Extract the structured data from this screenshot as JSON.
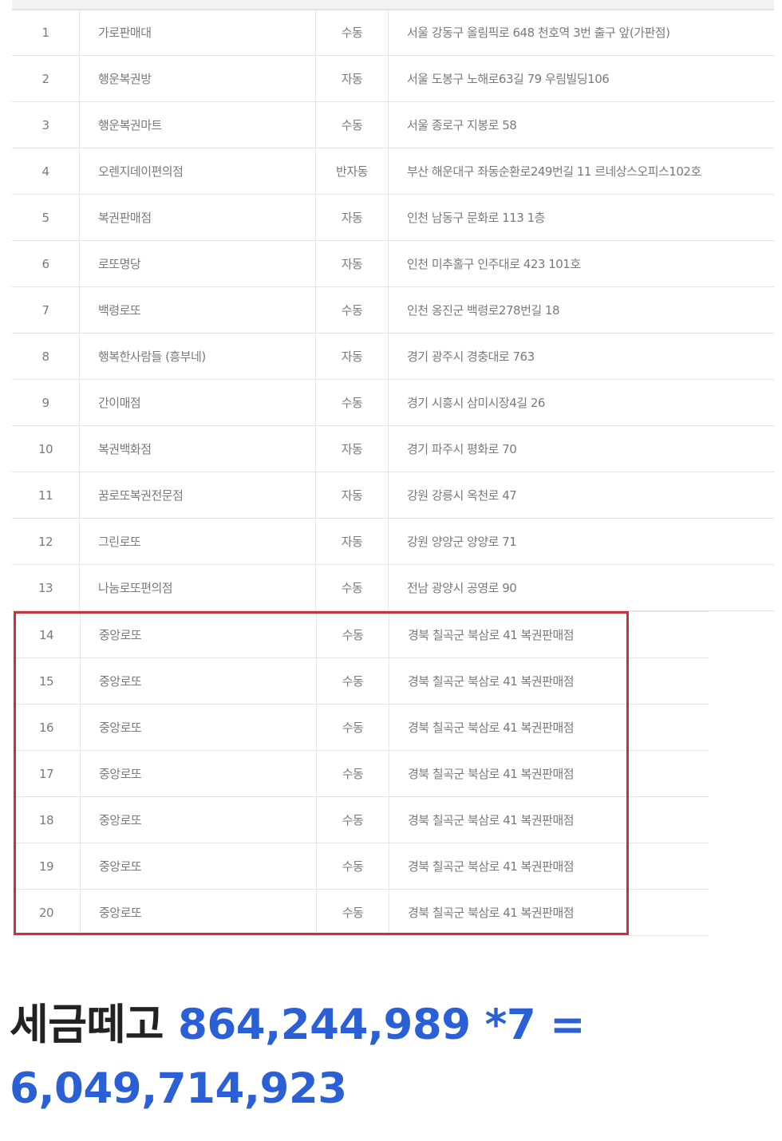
{
  "table": {
    "rows": [
      {
        "no": "1",
        "name": "가로판매대",
        "type": "수동",
        "address": "서울 강동구 올림픽로 648 천호역 3번 출구 앞(가판점)"
      },
      {
        "no": "2",
        "name": "행운복권방",
        "type": "자동",
        "address": "서울 도봉구 노해로63길 79 우림빌딩106"
      },
      {
        "no": "3",
        "name": "행운복권마트",
        "type": "수동",
        "address": "서울 종로구 지봉로 58"
      },
      {
        "no": "4",
        "name": "오렌지데이편의점",
        "type": "반자동",
        "address": "부산 해운대구 좌동순환로249번길 11 르네상스오피스102호"
      },
      {
        "no": "5",
        "name": "복권판매점",
        "type": "자동",
        "address": "인천 남동구 문화로 113 1층"
      },
      {
        "no": "6",
        "name": "로또명당",
        "type": "자동",
        "address": "인천 미추홀구 인주대로 423 101호"
      },
      {
        "no": "7",
        "name": "백령로또",
        "type": "수동",
        "address": "인천 옹진군 백령로278번길 18"
      },
      {
        "no": "8",
        "name": "행복한사람들 (흥부네)",
        "type": "자동",
        "address": "경기 광주시 경충대로 763"
      },
      {
        "no": "9",
        "name": "간이매점",
        "type": "수동",
        "address": "경기 시흥시 삼미시장4길 26"
      },
      {
        "no": "10",
        "name": "복권백화점",
        "type": "자동",
        "address": "경기 파주시 평화로 70"
      },
      {
        "no": "11",
        "name": "꿈로또복권전문점",
        "type": "자동",
        "address": "강원 강릉시 옥천로 47"
      },
      {
        "no": "12",
        "name": "그린로또",
        "type": "자동",
        "address": "강원 양양군 양양로 71"
      },
      {
        "no": "13",
        "name": "나눔로또편의점",
        "type": "수동",
        "address": "전남 광양시 공영로 90"
      },
      {
        "no": "14",
        "name": "중앙로또",
        "type": "수동",
        "address": "경북 칠곡군 북삼로 41 복권판매점"
      },
      {
        "no": "15",
        "name": "중앙로또",
        "type": "수동",
        "address": "경북 칠곡군 북삼로 41 복권판매점"
      },
      {
        "no": "16",
        "name": "중앙로또",
        "type": "수동",
        "address": "경북 칠곡군 북삼로 41 복권판매점"
      },
      {
        "no": "17",
        "name": "중앙로또",
        "type": "수동",
        "address": "경북 칠곡군 북삼로 41 복권판매점"
      },
      {
        "no": "18",
        "name": "중앙로또",
        "type": "수동",
        "address": "경북 칠곡군 북삼로 41 복권판매점"
      },
      {
        "no": "19",
        "name": "중앙로또",
        "type": "수동",
        "address": "경북 칠곡군 북삼로 41 복권판매점"
      },
      {
        "no": "20",
        "name": "중앙로또",
        "type": "수동",
        "address": "경북 칠곡군 북삼로 41 복권판매점"
      }
    ]
  },
  "highlight_color": "#c7333b",
  "caption": {
    "prefix": "세금떼고",
    "formula": "864,244,989 *7 = 6,049,714,923",
    "prefix_color": "#222222",
    "formula_color": "#2b5fd6"
  }
}
